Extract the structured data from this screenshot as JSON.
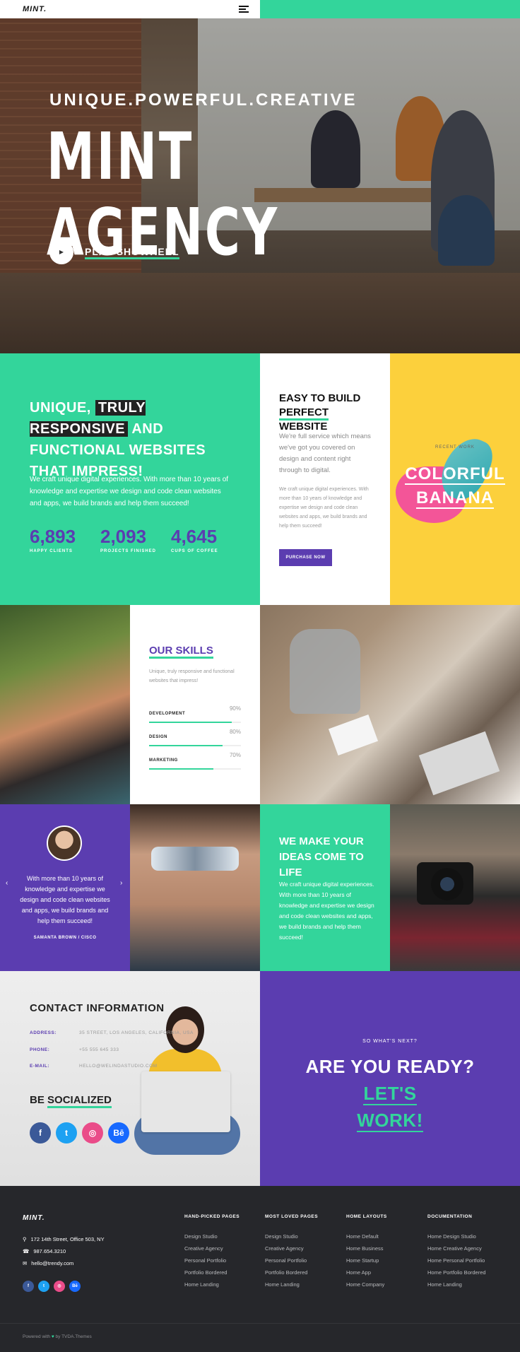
{
  "header": {
    "logo": "MINT.",
    "menu_icon": "hamburger-menu-icon"
  },
  "hero": {
    "subtitle": "UNIQUE.POWERFUL.CREATIVE",
    "title": "MINT AGENCY",
    "play_icon": "play-icon",
    "play_label": "PLAY SHOWREEL"
  },
  "intro": {
    "heading_pre": "UNIQUE, ",
    "heading_highlight": "TRULY RESPONSIVE",
    "heading_post": " AND FUNCTIONAL WEBSITES THAT IMPRESS!",
    "paragraph": "We craft unique digital experiences. With more than 10 years of knowledge and expertise we design and code clean websites and apps, we build brands and help them succeed!",
    "stats": [
      {
        "value": "6,893",
        "label": "HAPPY CLIENTS"
      },
      {
        "value": "2,093",
        "label": "PROJECTS FINISHED"
      },
      {
        "value": "4,645",
        "label": "CUPS OF COFFEE"
      }
    ]
  },
  "build": {
    "heading_line1": "EASY TO BUILD",
    "heading_underlined": "PERFECT",
    "heading_rest": " WEBSITE",
    "lead": "We're full service which means we've got you covered on design and content right through to digital.",
    "body": "We craft unique digital experiences. With more than 10 years of knowledge and expertise we design and code clean websites and apps, we build brands and help them succeed!",
    "button": "PURCHASE NOW"
  },
  "recent_work": {
    "label": "RECENT WORK",
    "title_line1": "COLORFUL",
    "title_line2": "BANANA"
  },
  "skills": {
    "heading": "OUR SKILLS",
    "description": "Unique, truly responsive and functional websites that impress!",
    "items": [
      {
        "name": "DEVELOPMENT",
        "percent_label": "90%",
        "value": 0.9
      },
      {
        "name": "DESIGN",
        "percent_label": "80%",
        "value": 0.8
      },
      {
        "name": "MARKETING",
        "percent_label": "70%",
        "value": 0.7
      }
    ]
  },
  "testimonial": {
    "quote": "With more than 10 years of knowledge and expertise we design and code clean websites and apps, we build brands and help them succeed!",
    "author": "SAMANTA BROWN / CISCO",
    "prev_icon": "chevron-left-icon",
    "next_icon": "chevron-right-icon"
  },
  "ideas": {
    "heading": "WE MAKE YOUR IDEAS COME TO LIFE",
    "paragraph": "We craft unique digital experiences. With more than 10 years of knowledge and expertise we design and code clean websites and apps, we build brands and help them succeed!"
  },
  "contact": {
    "heading": "CONTACT INFORMATION",
    "rows": [
      {
        "key": "ADDRESS:",
        "value": "35 STREET, LOS ANGELES, CALIFORNIA, USA"
      },
      {
        "key": "PHONE:",
        "value": "+55 555 645 333"
      },
      {
        "key": "E-MAIL:",
        "value": "HELLO@WELINDASTUDIO.COM"
      }
    ],
    "social_pre": "BE ",
    "social_underlined": "SOCIALIZED",
    "social": [
      {
        "icon": "facebook-icon",
        "glyph": "f",
        "color": "#3b5998"
      },
      {
        "icon": "twitter-icon",
        "glyph": "t",
        "color": "#1da1f2"
      },
      {
        "icon": "dribbble-icon",
        "glyph": "◎",
        "color": "#ea4c89"
      },
      {
        "icon": "behance-icon",
        "glyph": "Bē",
        "color": "#1769ff"
      }
    ]
  },
  "cta": {
    "kicker": "SO WHAT'S NEXT?",
    "heading_pre": "ARE YOU READY? ",
    "heading_green1": "LET'S",
    "heading_green2": "WORK!"
  },
  "footer": {
    "logo": "MINT.",
    "address": "172 14th Street, Office 503, NY",
    "phone": "987.654.3210",
    "email": "hello@trendy.com",
    "social": [
      {
        "icon": "facebook-icon",
        "glyph": "f",
        "color": "#3b5998"
      },
      {
        "icon": "twitter-icon",
        "glyph": "t",
        "color": "#1da1f2"
      },
      {
        "icon": "dribbble-icon",
        "glyph": "◎",
        "color": "#ea4c89"
      },
      {
        "icon": "behance-icon",
        "glyph": "Bē",
        "color": "#1769ff"
      }
    ],
    "columns": [
      {
        "heading": "HAND-PICKED PAGES",
        "links": [
          "Design Studio",
          "Creative Agency",
          "Personal Portfolio",
          "Portfolio Bordered",
          "Home Landing"
        ]
      },
      {
        "heading": "MOST LOVED PAGES",
        "links": [
          "Design Studio",
          "Creative Agency",
          "Personal Portfolio",
          "Portfolio Bordered",
          "Home Landing"
        ]
      },
      {
        "heading": "HOME LAYOUTS",
        "links": [
          "Home Default",
          "Home Business",
          "Home Startup",
          "Home App",
          "Home Company"
        ]
      },
      {
        "heading": "DOCUMENTATION",
        "links": [
          "Home Design Studio",
          "Home Creative Agency",
          "Home Personal Portfolio",
          "Home Portfolio Bordered",
          "Home Landing"
        ]
      }
    ],
    "powered_pre": "Powered with",
    "powered_post": "by TVDA.Themes"
  },
  "colors": {
    "mint": "#33d59b",
    "purple": "#5b3db0",
    "yellow": "#fcd03c",
    "dark": "#26272b"
  }
}
